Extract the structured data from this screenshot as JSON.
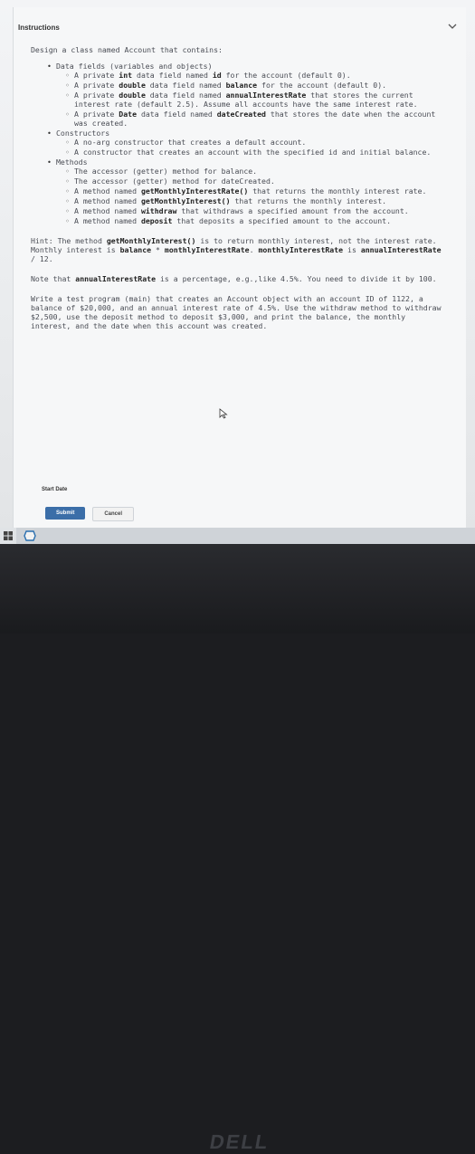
{
  "header": {
    "title": "Instructions"
  },
  "intro": "Design a class named Account that contains:",
  "sections": [
    {
      "label": "Data fields (variables and objects)",
      "items": [
        [
          "A private ",
          {
            "b": "int"
          },
          " data field named ",
          {
            "b": "id"
          },
          " for the account (default 0)."
        ],
        [
          "A private ",
          {
            "b": "double"
          },
          " data field named ",
          {
            "b": "balance"
          },
          " for the account (default 0)."
        ],
        [
          "A private ",
          {
            "b": "double"
          },
          " data field named ",
          {
            "b": "annualInterestRate"
          },
          " that stores the current interest rate (default 2.5). Assume all accounts have the same interest rate."
        ],
        [
          "A private ",
          {
            "b": "Date"
          },
          " data field named ",
          {
            "b": "dateCreated"
          },
          " that stores the date when the account was created."
        ]
      ]
    },
    {
      "label": "Constructors",
      "items": [
        [
          "A no-arg constructor that creates a default account."
        ],
        [
          "A constructor that creates an account with the specified id and initial balance."
        ]
      ]
    },
    {
      "label": "Methods",
      "items": [
        [
          "The accessor (getter) method for balance."
        ],
        [
          "The accessor (getter) method for dateCreated."
        ],
        [
          "A method named ",
          {
            "b": "getMonthlyInterestRate()"
          },
          " that returns the monthly interest rate."
        ],
        [
          "A method named ",
          {
            "b": "getMonthlyInterest()"
          },
          " that returns the monthly interest."
        ],
        [
          "A method named ",
          {
            "b": "withdraw"
          },
          " that withdraws a specified amount from the account."
        ],
        [
          "A method named ",
          {
            "b": "deposit"
          },
          " that deposits a specified amount to the account."
        ]
      ]
    }
  ],
  "paragraphs": [
    [
      "Hint: The method ",
      {
        "b": "getMonthlyInterest()"
      },
      " is to return monthly interest, not the interest rate. Monthly interest is ",
      {
        "b": "balance"
      },
      " * ",
      {
        "b": "monthlyInterestRate"
      },
      ". ",
      {
        "b": "monthlyInterestRate"
      },
      " is ",
      {
        "b": "annualInterestRate"
      },
      " / 12."
    ],
    [
      "Note that ",
      {
        "b": "annualInterestRate"
      },
      " is a percentage, e.g.,like 4.5%. You need to divide it by 100."
    ],
    [
      "Write a test program (main) that creates an Account object with an account ID of 1122, a balance of $20,000, and an annual interest rate of 4.5%. Use the withdraw method to withdraw $2,500, use the deposit method to deposit $3,000, and print the balance, the monthly interest, and the date when this account was created."
    ]
  ],
  "start_date_label": "Start Date",
  "buttons": {
    "submit": "Submit",
    "cancel": "Cancel"
  },
  "bezel_logo": "DELL",
  "colors": {
    "primary_button": "#3b6ea8",
    "taskbar": "#cfd3d8"
  }
}
